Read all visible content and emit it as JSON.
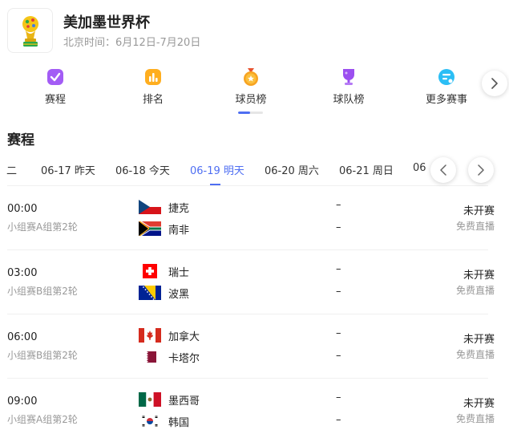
{
  "header": {
    "title": "美加墨世界杯",
    "subtitle": "北京时间：6月12日-7月20日"
  },
  "nav": {
    "items": [
      {
        "label": "赛程",
        "icon": "schedule-icon",
        "color": "#a35cf5"
      },
      {
        "label": "排名",
        "icon": "ranking-icon",
        "color": "#ffae1f"
      },
      {
        "label": "球员榜",
        "icon": "player-medal-icon",
        "color": "#f7a321"
      },
      {
        "label": "球队榜",
        "icon": "team-trophy-icon",
        "color": "#9c4ff0"
      },
      {
        "label": "更多赛事",
        "icon": "more-events-icon",
        "color": "#2bbef5"
      }
    ],
    "active_index": 2
  },
  "section": {
    "title": "赛程"
  },
  "date_tabs": [
    {
      "label": "二"
    },
    {
      "label": "06-17 昨天"
    },
    {
      "label": "06-18 今天"
    },
    {
      "label": "06-19 明天"
    },
    {
      "label": "06-20 周六"
    },
    {
      "label": "06-21 周日"
    },
    {
      "label": "06"
    }
  ],
  "active_date_index": 3,
  "matches": [
    {
      "time": "00:00",
      "round": "小组赛A组第2轮",
      "home": {
        "name": "捷克",
        "flag": "czech-flag"
      },
      "away": {
        "name": "南非",
        "flag": "south-africa-flag"
      },
      "home_score": "–",
      "away_score": "–",
      "status": "未开赛",
      "stream": "免费直播"
    },
    {
      "time": "03:00",
      "round": "小组赛B组第2轮",
      "home": {
        "name": "瑞士",
        "flag": "switzerland-flag"
      },
      "away": {
        "name": "波黑",
        "flag": "bosnia-flag"
      },
      "home_score": "–",
      "away_score": "–",
      "status": "未开赛",
      "stream": "免费直播"
    },
    {
      "time": "06:00",
      "round": "小组赛B组第2轮",
      "home": {
        "name": "加拿大",
        "flag": "canada-flag"
      },
      "away": {
        "name": "卡塔尔",
        "flag": "qatar-flag"
      },
      "home_score": "–",
      "away_score": "–",
      "status": "未开赛",
      "stream": "免费直播"
    },
    {
      "time": "09:00",
      "round": "小组赛A组第2轮",
      "home": {
        "name": "墨西哥",
        "flag": "mexico-flag"
      },
      "away": {
        "name": "韩国",
        "flag": "south-korea-flag"
      },
      "home_score": "–",
      "away_score": "–",
      "status": "未开赛",
      "stream": "免费直播"
    }
  ],
  "colors": {
    "accent": "#4e6ef2",
    "muted": "#999999"
  }
}
